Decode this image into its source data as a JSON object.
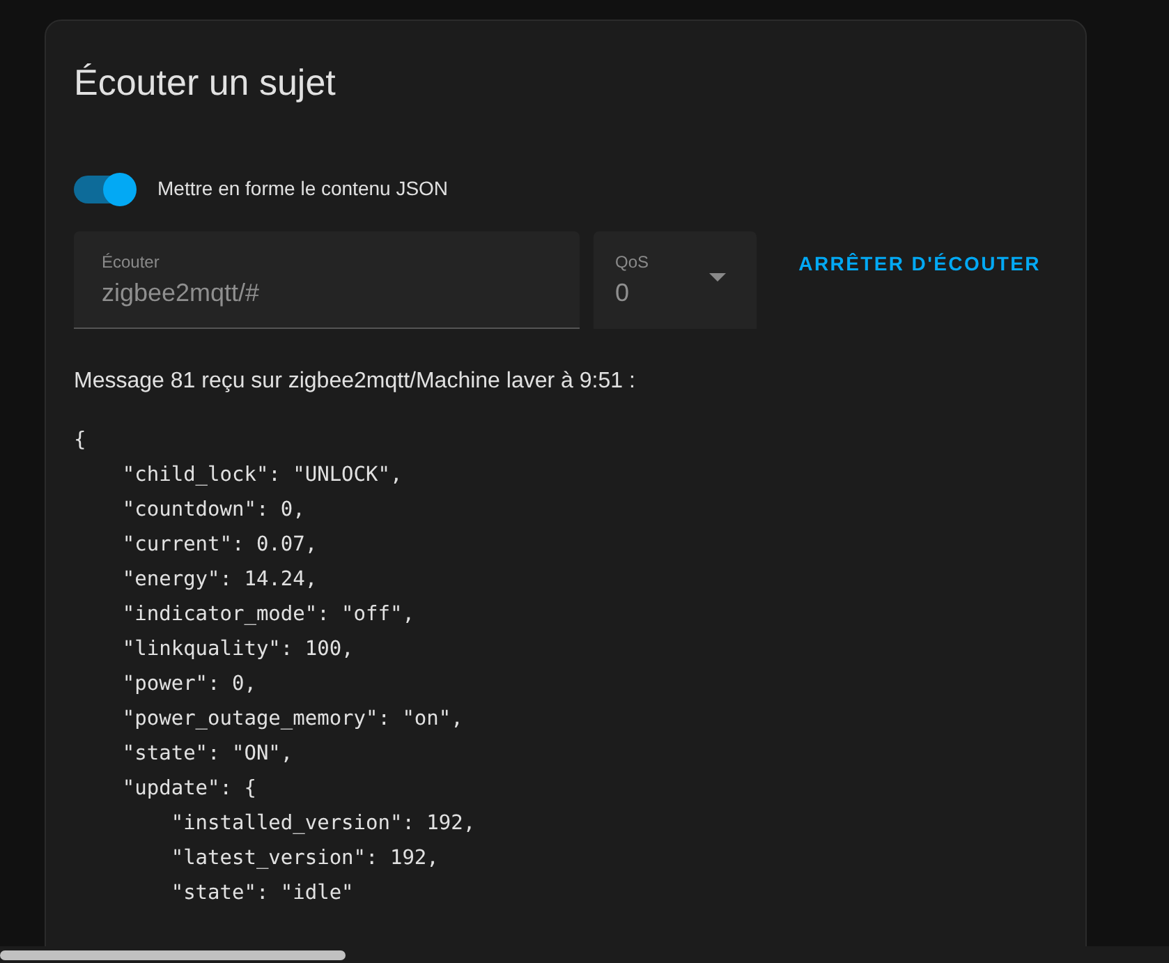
{
  "card": {
    "title": "Écouter un sujet"
  },
  "format_toggle": {
    "label": "Mettre en forme le contenu JSON",
    "on": true
  },
  "topic_field": {
    "label": "Écouter",
    "value": "zigbee2mqtt/#"
  },
  "qos_select": {
    "label": "QoS",
    "value": "0"
  },
  "stop_button": {
    "label": "ARRÊTER D'ÉCOUTER"
  },
  "message_header": "Message 81 reçu sur zigbee2mqtt/Machine laver à 9:51 :",
  "payload_lines": [
    "{",
    "    \"child_lock\": \"UNLOCK\",",
    "    \"countdown\": 0,",
    "    \"current\": 0.07,",
    "    \"energy\": 14.24,",
    "    \"indicator_mode\": \"off\",",
    "    \"linkquality\": 100,",
    "    \"power\": 0,",
    "    \"power_outage_memory\": \"on\",",
    "    \"state\": \"ON\",",
    "    \"update\": {",
    "        \"installed_version\": 192,",
    "        \"latest_version\": 192,",
    "        \"state\": \"idle\""
  ]
}
